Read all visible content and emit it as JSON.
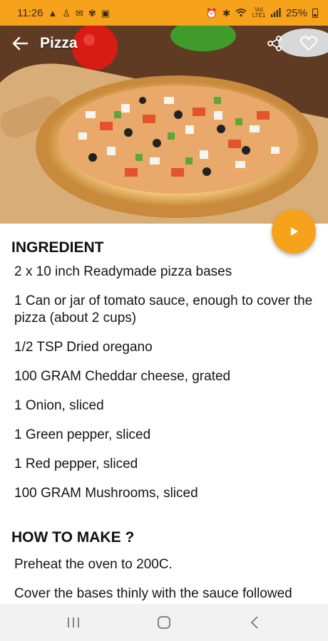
{
  "status_bar": {
    "time": "11:26",
    "left_icons": [
      "warning-icon",
      "notification-person-icon",
      "gmail-icon",
      "pinwheel-icon",
      "image-icon"
    ],
    "right_icons": [
      "alarm-icon",
      "bluetooth-icon",
      "wifi-icon",
      "volte-lte-icon",
      "signal-icon"
    ],
    "network_label": "Vo) LTE1",
    "battery": "25%"
  },
  "app_bar": {
    "title": "Pizza",
    "back_icon": "arrow-left-icon",
    "share_icon": "share-icon",
    "favorite_icon": "heart-outline-icon"
  },
  "hero": {
    "image": "pizza-photo"
  },
  "fab": {
    "icon": "play-icon",
    "color": "#f7a21b"
  },
  "ingredients": {
    "heading": "INGREDIENT",
    "items": [
      "2 x 10 inch Readymade pizza bases",
      "1 Can or jar of tomato sauce, enough to cover the pizza (about 2 cups)",
      "1/2 TSP Dried oregano",
      "100 GRAM Cheddar cheese, grated",
      "1 Onion, sliced",
      "1 Green pepper, sliced",
      "1 Red pepper, sliced",
      "100 GRAM Mushrooms, sliced"
    ]
  },
  "how_to_make": {
    "heading": "HOW TO MAKE ?",
    "steps": [
      "Preheat the oven to 200C.",
      "Cover the bases thinly with the sauce followed"
    ]
  },
  "nav_bar": {
    "icons": [
      "recent-apps-icon",
      "home-icon",
      "back-icon"
    ]
  },
  "colors": {
    "accent": "#f7a21b",
    "nav_background": "#f2f2f2"
  }
}
